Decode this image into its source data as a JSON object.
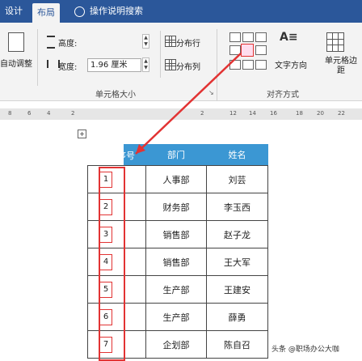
{
  "tabs": [
    {
      "label": "设计",
      "active": false
    },
    {
      "label": "布局",
      "active": true
    }
  ],
  "help": {
    "label": "操作说明搜索"
  },
  "ribbon": {
    "autofit_label": "自动调整",
    "height_label": "高度:",
    "width_label": "宽度:",
    "width_value": "1.96 厘米",
    "distribute_rows": "分布行",
    "distribute_cols": "分布列",
    "cell_size_group": "单元格大小",
    "text_direction": "文字方向",
    "cell_margins": "单元格边距",
    "alignment_group": "对齐方式"
  },
  "ruler": {
    "marks": [
      "8",
      "6",
      "4",
      "2",
      "2",
      "12",
      "14",
      "16",
      "18",
      "20",
      "22"
    ]
  },
  "table": {
    "headers": [
      "序号",
      "部门",
      "姓名"
    ],
    "rows": [
      {
        "index": "1",
        "dept": "人事部",
        "name": "刘芸"
      },
      {
        "index": "2",
        "dept": "财务部",
        "name": "李玉西"
      },
      {
        "index": "3",
        "dept": "销售部",
        "name": "赵子龙"
      },
      {
        "index": "4",
        "dept": "销售部",
        "name": "王大军"
      },
      {
        "index": "5",
        "dept": "生产部",
        "name": "王建安"
      },
      {
        "index": "6",
        "dept": "生产部",
        "name": "薛勇"
      },
      {
        "index": "7",
        "dept": "企划部",
        "name": "陈自召"
      }
    ]
  },
  "watermark": "头条 @职场办公大咖",
  "colors": {
    "ribbon_blue": "#2b579a",
    "header_blue": "#3b97d3",
    "highlight_red": "#e23333"
  }
}
